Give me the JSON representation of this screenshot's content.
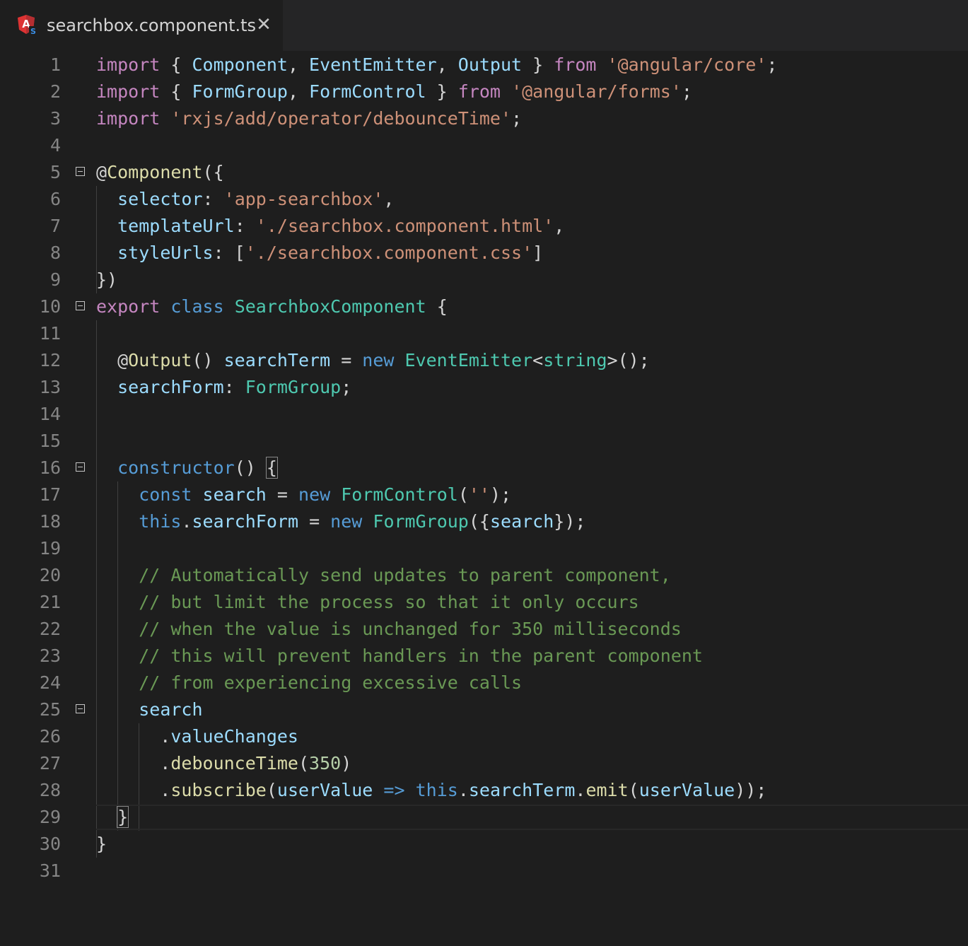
{
  "tab": {
    "file_name": "searchbox.component.ts",
    "close_glyph": "✕",
    "icon": "angular-typescript-icon",
    "icon_letter": "A",
    "icon_badge": "S",
    "icon_color": "#dd3333"
  },
  "lines": [
    {
      "n": "1",
      "tokens": [
        [
          "import",
          "kw"
        ],
        [
          " { ",
          "pl"
        ],
        [
          "Component",
          "vr"
        ],
        [
          ", ",
          "pl"
        ],
        [
          "EventEmitter",
          "vr"
        ],
        [
          ", ",
          "pl"
        ],
        [
          "Output",
          "vr"
        ],
        [
          " } ",
          "pl"
        ],
        [
          "from",
          "kw"
        ],
        [
          " ",
          "pl"
        ],
        [
          "'@angular/core'",
          "st"
        ],
        [
          ";",
          "pl"
        ]
      ]
    },
    {
      "n": "2",
      "tokens": [
        [
          "import",
          "kw"
        ],
        [
          " { ",
          "pl"
        ],
        [
          "FormGroup",
          "vr"
        ],
        [
          ", ",
          "pl"
        ],
        [
          "FormControl",
          "vr"
        ],
        [
          " } ",
          "pl"
        ],
        [
          "from",
          "kw"
        ],
        [
          " ",
          "pl"
        ],
        [
          "'@angular/forms'",
          "st"
        ],
        [
          ";",
          "pl"
        ]
      ]
    },
    {
      "n": "3",
      "tokens": [
        [
          "import",
          "kw"
        ],
        [
          " ",
          "pl"
        ],
        [
          "'rxjs/add/operator/debounceTime'",
          "st"
        ],
        [
          ";",
          "pl"
        ]
      ]
    },
    {
      "n": "4",
      "tokens": []
    },
    {
      "n": "5",
      "fold": true,
      "tokens": [
        [
          "@",
          "pl"
        ],
        [
          "Component",
          "fn"
        ],
        [
          "({",
          "pl"
        ]
      ]
    },
    {
      "n": "6",
      "tokens": [
        [
          "  ",
          "pl"
        ],
        [
          "selector",
          "vr"
        ],
        [
          ": ",
          "pl"
        ],
        [
          "'app-searchbox'",
          "st"
        ],
        [
          ",",
          "pl"
        ]
      ]
    },
    {
      "n": "7",
      "tokens": [
        [
          "  ",
          "pl"
        ],
        [
          "templateUrl",
          "vr"
        ],
        [
          ": ",
          "pl"
        ],
        [
          "'./searchbox.component.html'",
          "st"
        ],
        [
          ",",
          "pl"
        ]
      ]
    },
    {
      "n": "8",
      "tokens": [
        [
          "  ",
          "pl"
        ],
        [
          "styleUrls",
          "vr"
        ],
        [
          ": [",
          "pl"
        ],
        [
          "'./searchbox.component.css'",
          "st"
        ],
        [
          "]",
          "pl"
        ]
      ]
    },
    {
      "n": "9",
      "tokens": [
        [
          "})",
          "pl"
        ]
      ]
    },
    {
      "n": "10",
      "fold": true,
      "tokens": [
        [
          "export",
          "kw"
        ],
        [
          " ",
          "pl"
        ],
        [
          "class",
          "bl"
        ],
        [
          " ",
          "pl"
        ],
        [
          "SearchboxComponent",
          "ty"
        ],
        [
          " {",
          "pl"
        ]
      ]
    },
    {
      "n": "11",
      "tokens": []
    },
    {
      "n": "12",
      "tokens": [
        [
          "  @",
          "pl"
        ],
        [
          "Output",
          "fn"
        ],
        [
          "() ",
          "pl"
        ],
        [
          "searchTerm",
          "vr"
        ],
        [
          " = ",
          "pl"
        ],
        [
          "new",
          "bl"
        ],
        [
          " ",
          "pl"
        ],
        [
          "EventEmitter",
          "ty"
        ],
        [
          "<",
          "pl"
        ],
        [
          "string",
          "ty"
        ],
        [
          ">();",
          "pl"
        ]
      ]
    },
    {
      "n": "13",
      "tokens": [
        [
          "  ",
          "pl"
        ],
        [
          "searchForm",
          "vr"
        ],
        [
          ": ",
          "pl"
        ],
        [
          "FormGroup",
          "ty"
        ],
        [
          ";",
          "pl"
        ]
      ]
    },
    {
      "n": "14",
      "tokens": []
    },
    {
      "n": "15",
      "tokens": []
    },
    {
      "n": "16",
      "fold": true,
      "tokens": [
        [
          "  ",
          "pl"
        ],
        [
          "constructor",
          "bl"
        ],
        [
          "() ",
          "pl"
        ],
        [
          "{",
          "pl",
          "bracket-box"
        ]
      ]
    },
    {
      "n": "17",
      "tokens": [
        [
          "    ",
          "pl"
        ],
        [
          "const",
          "bl"
        ],
        [
          " ",
          "pl"
        ],
        [
          "search",
          "vr"
        ],
        [
          " = ",
          "pl"
        ],
        [
          "new",
          "bl"
        ],
        [
          " ",
          "pl"
        ],
        [
          "FormControl",
          "ty"
        ],
        [
          "(",
          "pl"
        ],
        [
          "''",
          "st"
        ],
        [
          ");",
          "pl"
        ]
      ]
    },
    {
      "n": "18",
      "tokens": [
        [
          "    ",
          "pl"
        ],
        [
          "this",
          "bl"
        ],
        [
          ".",
          "pl"
        ],
        [
          "searchForm",
          "vr"
        ],
        [
          " = ",
          "pl"
        ],
        [
          "new",
          "bl"
        ],
        [
          " ",
          "pl"
        ],
        [
          "FormGroup",
          "ty"
        ],
        [
          "({",
          "pl"
        ],
        [
          "search",
          "vr"
        ],
        [
          "});",
          "pl"
        ]
      ]
    },
    {
      "n": "19",
      "tokens": []
    },
    {
      "n": "20",
      "tokens": [
        [
          "    ",
          "pl"
        ],
        [
          "// Automatically send updates to parent component,",
          "cm"
        ]
      ]
    },
    {
      "n": "21",
      "tokens": [
        [
          "    ",
          "pl"
        ],
        [
          "// but limit the process so that it only occurs",
          "cm"
        ]
      ]
    },
    {
      "n": "22",
      "tokens": [
        [
          "    ",
          "pl"
        ],
        [
          "// when the value is unchanged for 350 milliseconds",
          "cm"
        ]
      ]
    },
    {
      "n": "23",
      "tokens": [
        [
          "    ",
          "pl"
        ],
        [
          "// this will prevent handlers in the parent component",
          "cm"
        ]
      ]
    },
    {
      "n": "24",
      "tokens": [
        [
          "    ",
          "pl"
        ],
        [
          "// from experiencing excessive calls",
          "cm"
        ]
      ]
    },
    {
      "n": "25",
      "fold": true,
      "tokens": [
        [
          "    ",
          "pl"
        ],
        [
          "search",
          "vr"
        ]
      ]
    },
    {
      "n": "26",
      "tokens": [
        [
          "      .",
          "pl"
        ],
        [
          "valueChanges",
          "vr"
        ]
      ]
    },
    {
      "n": "27",
      "tokens": [
        [
          "      .",
          "pl"
        ],
        [
          "debounceTime",
          "fn"
        ],
        [
          "(",
          "pl"
        ],
        [
          "350",
          "nu"
        ],
        [
          ")",
          "pl"
        ]
      ]
    },
    {
      "n": "28",
      "tokens": [
        [
          "      .",
          "pl"
        ],
        [
          "subscribe",
          "fn"
        ],
        [
          "(",
          "pl"
        ],
        [
          "userValue",
          "vr"
        ],
        [
          " ",
          "pl"
        ],
        [
          "=>",
          "bl"
        ],
        [
          " ",
          "pl"
        ],
        [
          "this",
          "bl"
        ],
        [
          ".",
          "pl"
        ],
        [
          "searchTerm",
          "vr"
        ],
        [
          ".",
          "pl"
        ],
        [
          "emit",
          "fn"
        ],
        [
          "(",
          "pl"
        ],
        [
          "userValue",
          "vr"
        ],
        [
          "));",
          "pl"
        ]
      ]
    },
    {
      "n": "29",
      "current": true,
      "tokens": [
        [
          "  ",
          "pl"
        ],
        [
          "}",
          "pl",
          "bracket-box"
        ]
      ]
    },
    {
      "n": "30",
      "tokens": [
        [
          "}",
          "pl"
        ]
      ]
    },
    {
      "n": "31",
      "tokens": []
    }
  ]
}
